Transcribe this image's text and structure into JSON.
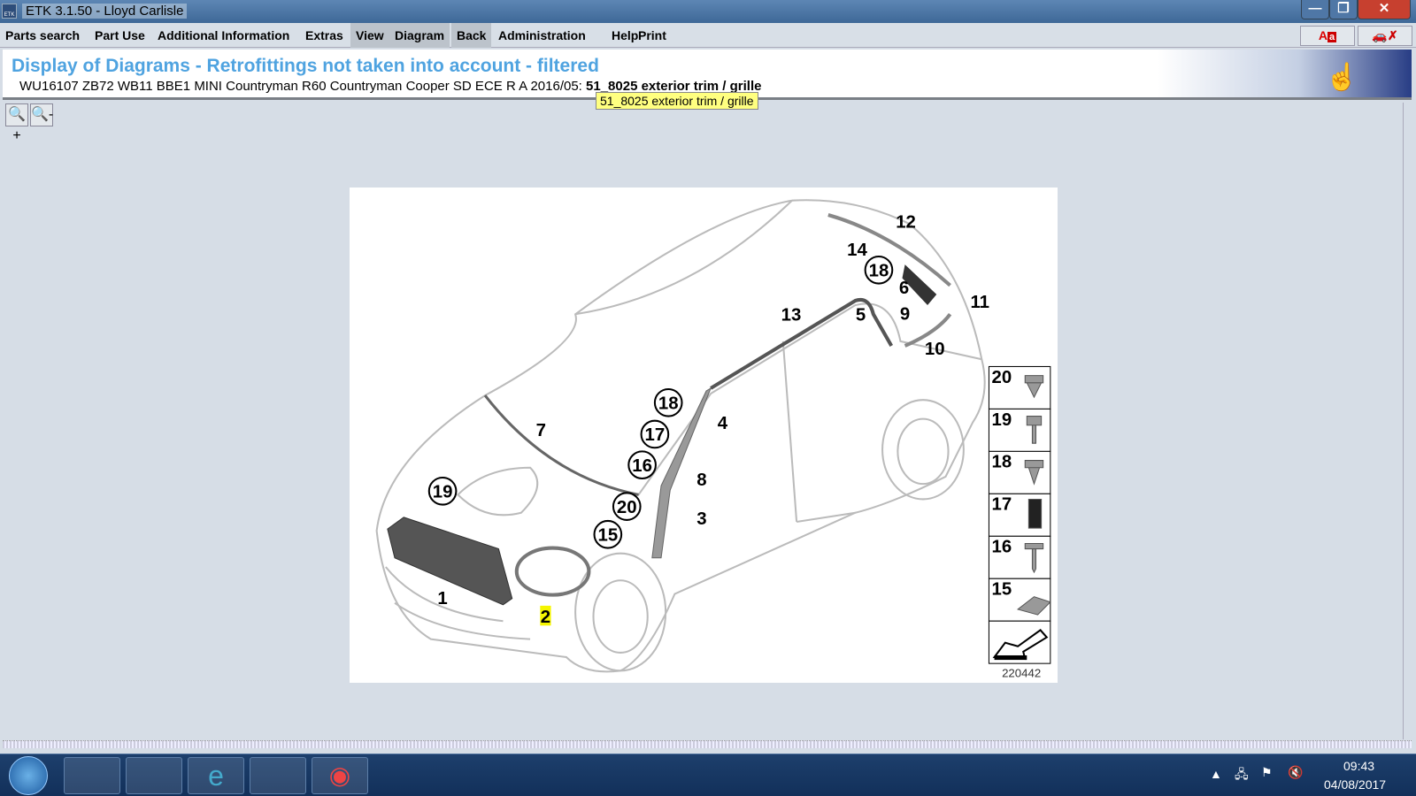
{
  "window": {
    "title": "ETK 3.1.50 - Lloyd Carlisle",
    "app_icon": "ETK"
  },
  "menu": [
    "Parts search",
    "Part Use",
    "Additional Information",
    "Extras",
    "View",
    "Diagram",
    "Back",
    "Administration",
    "Help",
    "Print"
  ],
  "toolbar": {
    "font_toggle": "A",
    "vehicle_icon": "vehicle-crossed-icon"
  },
  "header": {
    "title": "Display of Diagrams - Retrofittings not taken into account - filtered",
    "vehicle": "WU16107 ZB72 WB11 BBE1 MINI Countryman R60 Countryman Cooper SD ECE R A 2016/05:",
    "group": "51_8025 exterior trim / grille",
    "title_color": "#4fa3e0"
  },
  "tooltip": "51_8025 exterior trim / grille",
  "zoom": {
    "in": "zoom-in-icon",
    "out": "zoom-out-icon"
  },
  "diagram": {
    "callouts": [
      "12",
      "14",
      "18",
      "6",
      "11",
      "13",
      "5",
      "9",
      "10",
      "18",
      "4",
      "17",
      "7",
      "16",
      "8",
      "19",
      "20",
      "3",
      "15",
      "1",
      "2"
    ],
    "circled": [
      false,
      false,
      true,
      false,
      false,
      false,
      false,
      false,
      false,
      true,
      false,
      true,
      false,
      true,
      false,
      true,
      true,
      false,
      true,
      false,
      false
    ],
    "highlighted_callout": "2",
    "legend": [
      "20",
      "19",
      "18",
      "17",
      "16",
      "15"
    ],
    "diagram_id": "220442"
  },
  "taskbar": {
    "time": "09:43",
    "date": "04/08/2017"
  }
}
